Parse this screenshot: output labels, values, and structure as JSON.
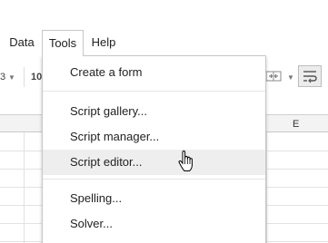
{
  "menubar": {
    "items": [
      {
        "label": "Data"
      },
      {
        "label": "Tools"
      },
      {
        "label": "Help"
      }
    ]
  },
  "toolbar": {
    "font_size_partial": "3",
    "font_size_partial_2": "10",
    "wrap_icon": "wrap-text-icon",
    "merge_icon": "merge-cells-icon"
  },
  "grid": {
    "column_e": "E"
  },
  "tools_menu": {
    "items": [
      {
        "label": "Create a form"
      },
      {
        "label": "Script gallery..."
      },
      {
        "label": "Script manager..."
      },
      {
        "label": "Script editor..."
      },
      {
        "label": "Spelling..."
      },
      {
        "label": "Solver..."
      }
    ],
    "hovered": "Script editor..."
  }
}
